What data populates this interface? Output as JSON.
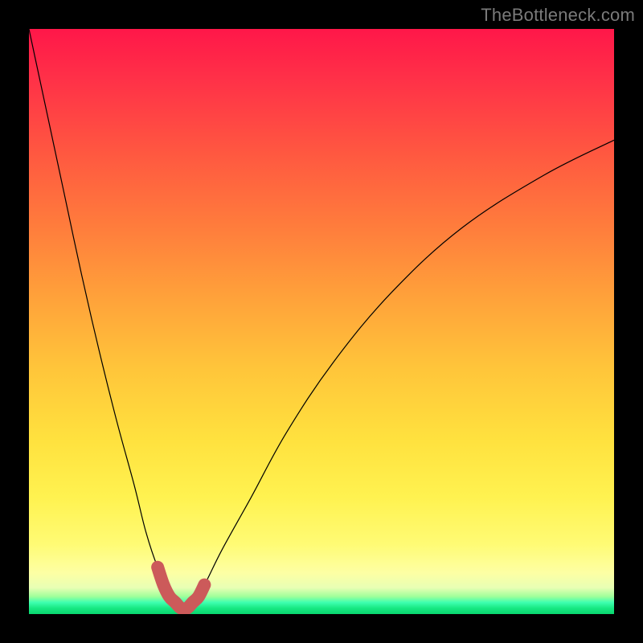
{
  "watermark": "TheBottleneck.com",
  "colors": {
    "page_bg": "#000000",
    "curve_thin": "#000000",
    "curve_thick": "#cc5a5a",
    "gradient_top": "#ff1749",
    "gradient_bottom": "#09d66f"
  },
  "chart_data": {
    "type": "line",
    "title": "",
    "xlabel": "",
    "ylabel": "",
    "xlim": [
      0,
      100
    ],
    "ylim": [
      0,
      100
    ],
    "axes_visible": false,
    "grid": false,
    "legend": false,
    "series": [
      {
        "name": "bottleneck-curve",
        "x": [
          0,
          3,
          6,
          9,
          12,
          15,
          18,
          20,
          22,
          24,
          25,
          26,
          27,
          28,
          30,
          33,
          38,
          44,
          52,
          62,
          74,
          88,
          100
        ],
        "values": [
          100,
          86,
          72,
          58,
          45,
          33,
          22,
          14,
          8,
          4,
          2,
          1,
          1,
          2,
          5,
          11,
          20,
          31,
          43,
          55,
          66,
          75,
          81
        ]
      },
      {
        "name": "optimal-band",
        "x": [
          22,
          23,
          24,
          25,
          26,
          27,
          28,
          29,
          30
        ],
        "values": [
          8,
          5,
          3,
          2,
          1,
          1,
          2,
          3,
          5
        ]
      }
    ],
    "notes": "V-shaped bottleneck curve. Minimum (optimal point) around x≈26–27. Left branch starts at top-left corner (y=100 at x=0). Right branch exits near y≈81 at x=100. Thick salmon overlay marks the low region around the minimum (roughly x 22–30, y ≤ ~8)."
  }
}
